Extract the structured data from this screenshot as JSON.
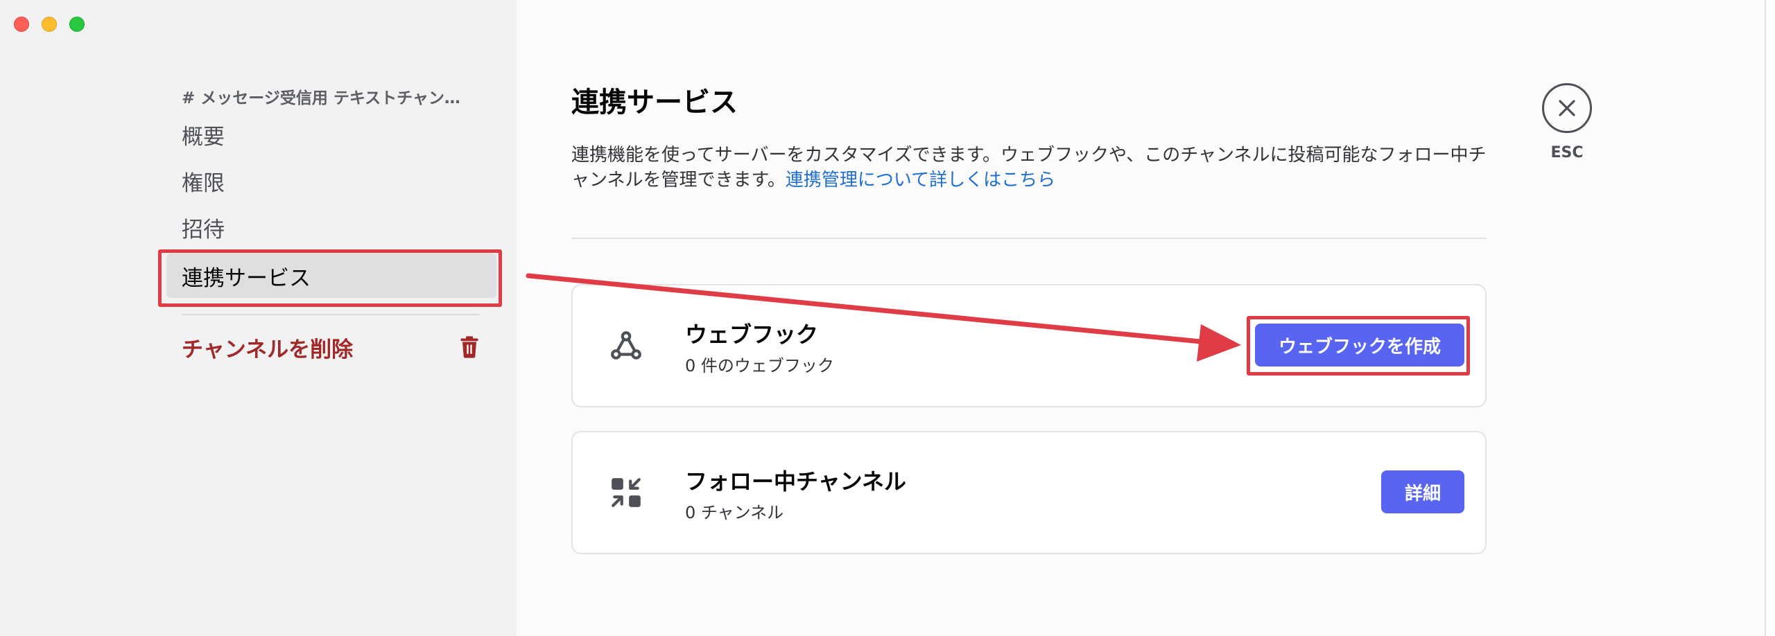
{
  "sidebar": {
    "channel_header": "# メッセージ受信用 テキストチャン…",
    "items": [
      {
        "label": "概要"
      },
      {
        "label": "権限"
      },
      {
        "label": "招待"
      },
      {
        "label": "連携サービス"
      }
    ],
    "delete_label": "チャンネルを削除"
  },
  "main": {
    "title": "連携サービス",
    "description": "連携機能を使ってサーバーをカスタマイズできます。ウェブフックや、このチャンネルに投稿可能なフォロー中チャンネルを管理できます。",
    "learn_more_link": "連携管理について詳しくはこちら",
    "cards": [
      {
        "title": "ウェブフック",
        "subtitle": "0 件のウェブフック",
        "button": "ウェブフックを作成",
        "icon": "webhook-icon"
      },
      {
        "title": "フォロー中チャンネル",
        "subtitle": "0 チャンネル",
        "button": "詳細",
        "icon": "follow-channel-icon"
      }
    ]
  },
  "close": {
    "label": "ESC"
  },
  "colors": {
    "accent": "#5865f2",
    "danger": "#a12828",
    "annotation": "#e03c45",
    "link": "#1f6fd0"
  }
}
